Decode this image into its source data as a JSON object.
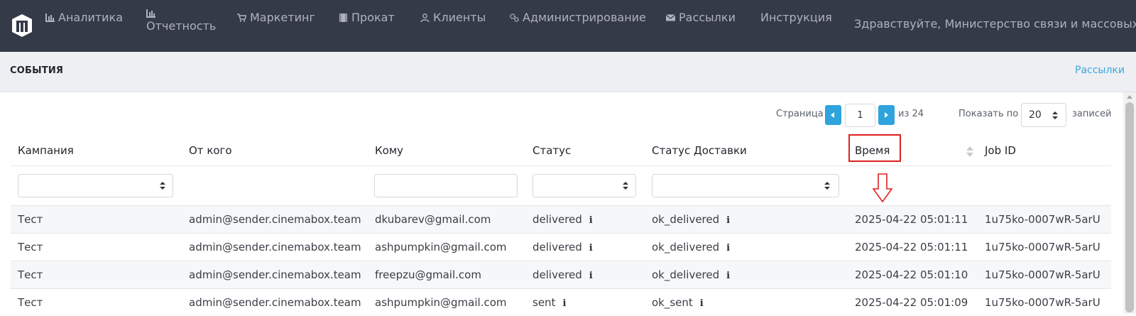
{
  "nav": {
    "items": [
      {
        "label": "Аналитика",
        "icon": "bar-chart-icon"
      },
      {
        "label": "Отчетность",
        "icon": "bar-chart-icon"
      },
      {
        "label": "Маркетинг",
        "icon": "cart-icon"
      },
      {
        "label": "Прокат",
        "icon": "film-icon"
      },
      {
        "label": "Клиенты",
        "icon": "user-icon"
      },
      {
        "label": "Администрирование",
        "icon": "gears-icon"
      },
      {
        "label": "Рассылки",
        "icon": "envelope-icon"
      },
      {
        "label": "Инструкция",
        "icon": ""
      }
    ],
    "greeting": "Здравствуйте, Министерство связи и массовых ком"
  },
  "subheader": {
    "title": "СОБЫТИЯ",
    "link": "Рассылки"
  },
  "pagination": {
    "page_label": "Страница",
    "page_value": "1",
    "total_label": "из 24",
    "show_label": "Показать по",
    "page_size": "20",
    "records_label": "записей"
  },
  "table": {
    "columns": [
      "Кампания",
      "От кого",
      "Кому",
      "Статус",
      "Статус Доставки",
      "Время",
      "Job ID"
    ],
    "rows": [
      {
        "campaign": "Тест",
        "from": "admin@sender.cinemabox.team",
        "to": "dkubarev@gmail.com",
        "status": "delivered",
        "delivery": "ok_delivered",
        "time": "2025-04-22 05:01:11",
        "job": "1u75ko-0007wR-5arU"
      },
      {
        "campaign": "Тест",
        "from": "admin@sender.cinemabox.team",
        "to": "ashpumpkin@gmail.com",
        "status": "delivered",
        "delivery": "ok_delivered",
        "time": "2025-04-22 05:01:11",
        "job": "1u75ko-0007wR-5arU"
      },
      {
        "campaign": "Тест",
        "from": "admin@sender.cinemabox.team",
        "to": "freepzu@gmail.com",
        "status": "delivered",
        "delivery": "ok_delivered",
        "time": "2025-04-22 05:01:10",
        "job": "1u75ko-0007wR-5arU"
      },
      {
        "campaign": "Тест",
        "from": "admin@sender.cinemabox.team",
        "to": "ashpumpkin@gmail.com",
        "status": "sent",
        "delivery": "ok_sent",
        "time": "2025-04-22 05:01:09",
        "job": "1u75ko-0007wR-5arU"
      }
    ],
    "info_glyph": "i"
  },
  "colors": {
    "navbar": "#343a47",
    "accent": "#2ea3dc",
    "highlight": "#e02020"
  }
}
